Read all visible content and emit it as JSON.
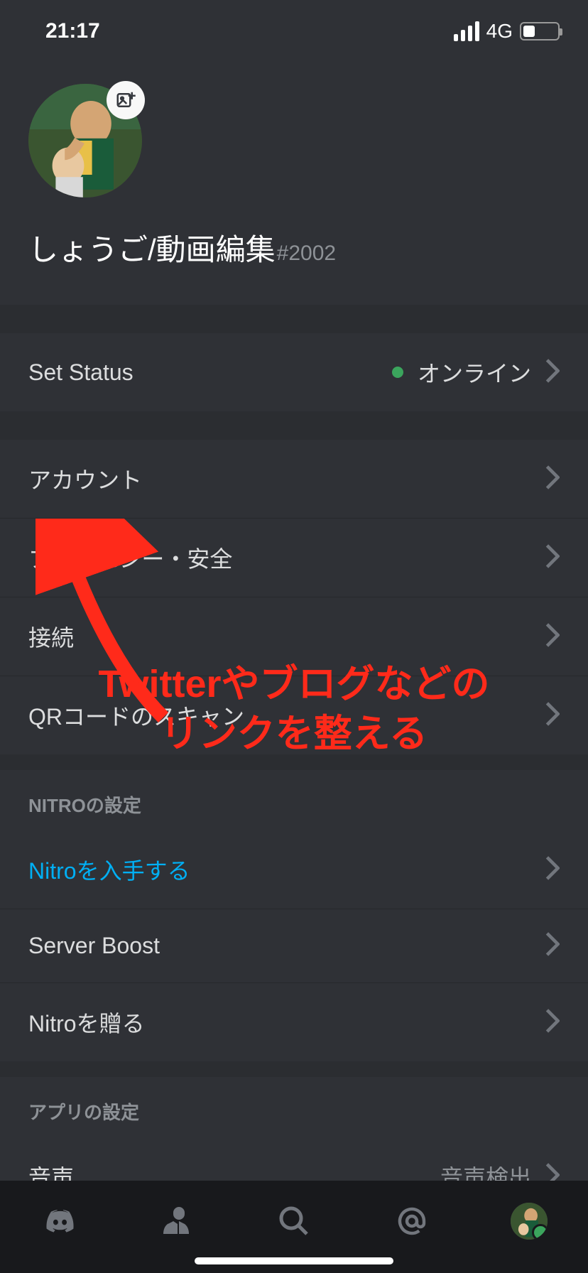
{
  "status_bar": {
    "time": "21:17",
    "network": "4G"
  },
  "profile": {
    "username": "しょうご/動画編集",
    "discriminator": "#2002"
  },
  "set_status": {
    "label": "Set Status",
    "value": "オンライン"
  },
  "account_section": {
    "items": [
      {
        "label": "アカウント"
      },
      {
        "label": "プライバシー・安全"
      },
      {
        "label": "接続"
      },
      {
        "label": "QRコードのスキャン"
      }
    ]
  },
  "nitro_section": {
    "title": "NITROの設定",
    "items": [
      {
        "label": "Nitroを入手する",
        "link": true
      },
      {
        "label": "Server Boost"
      },
      {
        "label": "Nitroを贈る"
      }
    ]
  },
  "app_section": {
    "title": "アプリの設定",
    "items": [
      {
        "label": "音声",
        "value": "音声検出"
      }
    ]
  },
  "annotation": {
    "line1": "Twitterやブログなどの",
    "line2": "リンクを整える"
  }
}
